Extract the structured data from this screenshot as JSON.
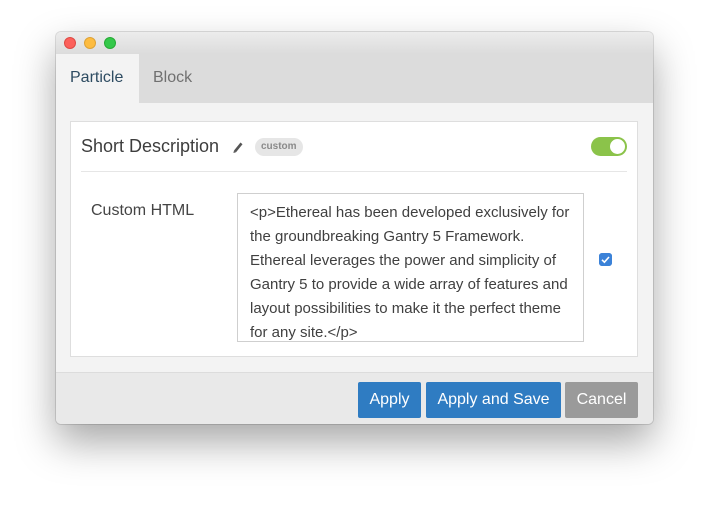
{
  "tabs": [
    {
      "label": "Particle",
      "active": true
    },
    {
      "label": "Block",
      "active": false
    }
  ],
  "panel": {
    "title": "Short Description",
    "title_icon": "pencil-icon",
    "badge": "custom",
    "enabled": true
  },
  "field": {
    "label": "Custom HTML",
    "value": "<p>Ethereal has been developed exclusively for the groundbreaking Gantry 5 Framework. Ethereal leverages the power and simplicity of Gantry 5 to provide a wide array of features and layout possibilities to make it the perfect theme for any site.</p>",
    "checkbox_checked": true
  },
  "buttons": {
    "apply": "Apply",
    "apply_save": "Apply and Save",
    "cancel": "Cancel"
  },
  "colors": {
    "primary": "#2f7cc2",
    "toggle_on": "#8bc34a",
    "cancel": "#9a9a9a"
  }
}
